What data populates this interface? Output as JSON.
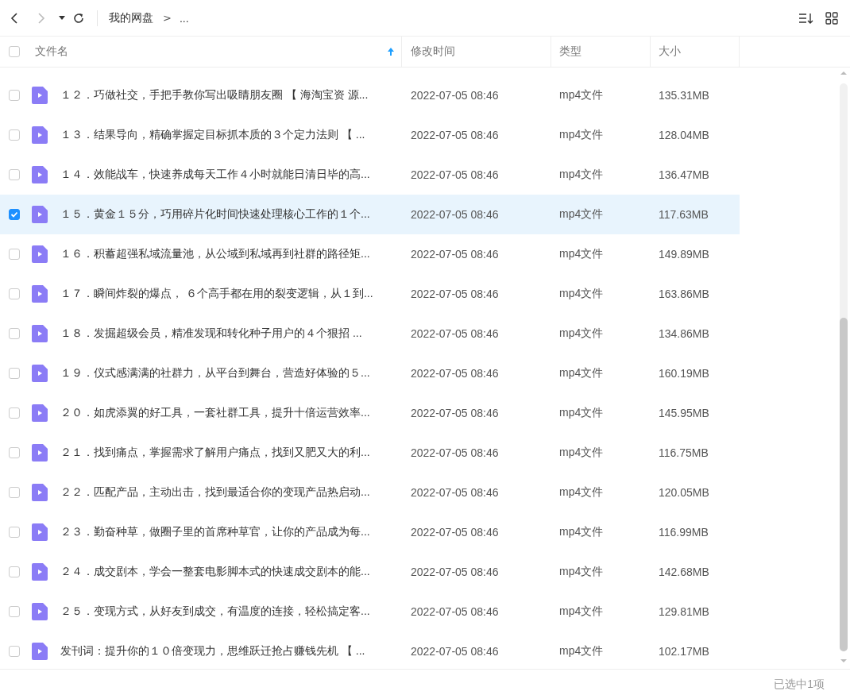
{
  "toolbar": {
    "breadcrumb": [
      {
        "label": "我的网盘",
        "kind": "crumb"
      },
      {
        "label": ">",
        "kind": "separator"
      },
      {
        "label": "...",
        "kind": "crumb"
      }
    ]
  },
  "table": {
    "select_all": {
      "checked": false
    },
    "columns": [
      {
        "label": "文件名",
        "sorted": true
      },
      {
        "label": "修改时间",
        "sorted": false
      },
      {
        "label": "类型",
        "sorted": false
      },
      {
        "label": "大小",
        "sorted": false
      }
    ],
    "rows": [
      {
        "name": "１２．巧做社交，手把手教你写出吸睛朋友圈 【 海淘宝资 源...",
        "modified": "2022-07-05 08:46",
        "type": "mp4文件",
        "size": "135.31MB",
        "selected": false
      },
      {
        "name": "１３．结果导向，精确掌握定目标抓本质的３个定力法则 【 ...",
        "modified": "2022-07-05 08:46",
        "type": "mp4文件",
        "size": "128.04MB",
        "selected": false
      },
      {
        "name": "１４．效能战车，快速养成每天工作４小时就能日清日毕的高...",
        "modified": "2022-07-05 08:46",
        "type": "mp4文件",
        "size": "136.47MB",
        "selected": false
      },
      {
        "name": "１５．黄金１５分，巧用碎片化时间快速处理核心工作的１个...",
        "modified": "2022-07-05 08:46",
        "type": "mp4文件",
        "size": "117.63MB",
        "selected": true
      },
      {
        "name": "１６．积蓄超强私域流量池，从公域到私域再到社群的路径矩...",
        "modified": "2022-07-05 08:46",
        "type": "mp4文件",
        "size": "149.89MB",
        "selected": false
      },
      {
        "name": "１７．瞬间炸裂的爆点， ６个高手都在用的裂变逻辑，从１到...",
        "modified": "2022-07-05 08:46",
        "type": "mp4文件",
        "size": "163.86MB",
        "selected": false
      },
      {
        "name": "１８．发掘超级会员，精准发现和转化种子用户的４个狠招 ...",
        "modified": "2022-07-05 08:46",
        "type": "mp4文件",
        "size": "134.86MB",
        "selected": false
      },
      {
        "name": "１９．仪式感满满的社群力，从平台到舞台，营造好体验的５...",
        "modified": "2022-07-05 08:46",
        "type": "mp4文件",
        "size": "160.19MB",
        "selected": false
      },
      {
        "name": "２０．如虎添翼的好工具，一套社群工具，提升十倍运营效率...",
        "modified": "2022-07-05 08:46",
        "type": "mp4文件",
        "size": "145.95MB",
        "selected": false
      },
      {
        "name": "２１．找到痛点，掌握需求了解用户痛点，找到又肥又大的利...",
        "modified": "2022-07-05 08:46",
        "type": "mp4文件",
        "size": "116.75MB",
        "selected": false
      },
      {
        "name": "２２．匹配产品，主动出击，找到最适合你的变现产品热启动...",
        "modified": "2022-07-05 08:46",
        "type": "mp4文件",
        "size": "120.05MB",
        "selected": false
      },
      {
        "name": "２３．勤奋种草，做圈子里的首席种草官，让你的产品成为每...",
        "modified": "2022-07-05 08:46",
        "type": "mp4文件",
        "size": "116.99MB",
        "selected": false
      },
      {
        "name": "２４．成交剧本，学会一整套电影脚本式的快速成交剧本的能...",
        "modified": "2022-07-05 08:46",
        "type": "mp4文件",
        "size": "142.68MB",
        "selected": false
      },
      {
        "name": "２５．变现方式，从好友到成交，有温度的连接，轻松搞定客...",
        "modified": "2022-07-05 08:46",
        "type": "mp4文件",
        "size": "129.81MB",
        "selected": false
      },
      {
        "name": "发刊词：提升你的１０倍变现力，思维跃迁抢占赚钱先机 【 ...",
        "modified": "2022-07-05 08:46",
        "type": "mp4文件",
        "size": "102.17MB",
        "selected": false
      }
    ]
  },
  "status_bar": {
    "text": "已选中1项"
  }
}
